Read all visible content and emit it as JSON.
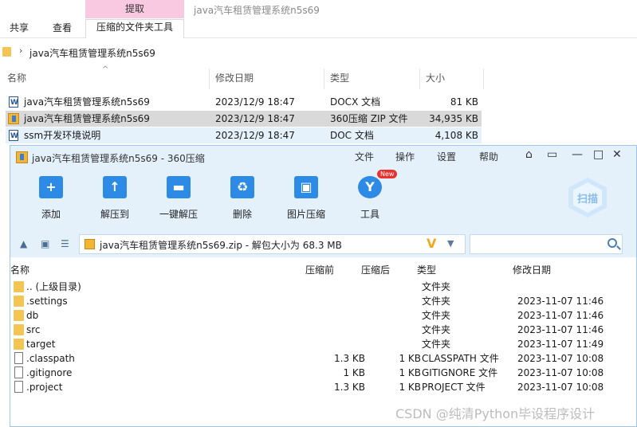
{
  "explorer": {
    "ribbon": {
      "context_header": "提取",
      "window_title": "java汽车租赁管理系统n5s69",
      "tabs": [
        "共享",
        "查看",
        "压缩的文件夹工具"
      ]
    },
    "address": "java汽车租赁管理系统n5s69",
    "columns": [
      "名称",
      "修改日期",
      "类型",
      "大小"
    ],
    "files": [
      {
        "name": "java汽车租赁管理系统n5s69",
        "date": "2023/12/9 18:47",
        "type": "DOCX 文档",
        "size": "81 KB",
        "icon": "word-doc-icon"
      },
      {
        "name": "java汽车租赁管理系统n5s69",
        "date": "2023/12/9 18:47",
        "type": "360压缩 ZIP 文件",
        "size": "34,935 KB",
        "icon": "zip-icon"
      },
      {
        "name": "ssm开发环境说明",
        "date": "2023/12/9 18:47",
        "type": "DOC 文档",
        "size": "4,108 KB",
        "icon": "word-doc-icon"
      }
    ]
  },
  "zip": {
    "title": "java汽车租赁管理系统n5s69 - 360压缩",
    "menu": [
      "文件",
      "操作",
      "设置",
      "帮助"
    ],
    "toolbar": [
      {
        "label": "添加",
        "icon": "add-icon"
      },
      {
        "label": "解压到",
        "icon": "extract-to-icon"
      },
      {
        "label": "一键解压",
        "icon": "one-click-extract-icon"
      },
      {
        "label": "删除",
        "icon": "delete-icon"
      },
      {
        "label": "图片压缩",
        "icon": "image-compress-icon"
      },
      {
        "label": "工具",
        "icon": "tools-icon",
        "badge": "New"
      }
    ],
    "scan_label": "扫描",
    "path": "java汽车租赁管理系统n5s69.zip - 解包大小为 68.3 MB",
    "path_badge": "V",
    "columns": [
      "名称",
      "压缩前",
      "压缩后",
      "类型",
      "修改日期"
    ],
    "rows": [
      {
        "name": ".. (上级目录)",
        "before": "",
        "after": "",
        "type": "文件夹",
        "date": "",
        "kind": "folder"
      },
      {
        "name": ".settings",
        "before": "",
        "after": "",
        "type": "文件夹",
        "date": "2023-11-07 11:46",
        "kind": "folder"
      },
      {
        "name": "db",
        "before": "",
        "after": "",
        "type": "文件夹",
        "date": "2023-11-07 11:46",
        "kind": "folder"
      },
      {
        "name": "src",
        "before": "",
        "after": "",
        "type": "文件夹",
        "date": "2023-11-07 11:46",
        "kind": "folder"
      },
      {
        "name": "target",
        "before": "",
        "after": "",
        "type": "文件夹",
        "date": "2023-11-07 11:49",
        "kind": "folder"
      },
      {
        "name": ".classpath",
        "before": "1.3 KB",
        "after": "1 KB",
        "type": "CLASSPATH 文件",
        "date": "2023-11-07 10:08",
        "kind": "file"
      },
      {
        "name": ".gitignore",
        "before": "1 KB",
        "after": "1 KB",
        "type": "GITIGNORE 文件",
        "date": "2023-11-07 10:08",
        "kind": "file"
      },
      {
        "name": ".project",
        "before": "1.3 KB",
        "after": "1 KB",
        "type": "PROJECT 文件",
        "date": "2023-11-07 10:08",
        "kind": "file"
      }
    ]
  },
  "watermark": "CSDN @纯清Python毕设程序设计",
  "colors": {
    "accent_blue": "#2d8be6",
    "zip_header_bg": "#e4f1fb",
    "selected_row": "#d9d9d9",
    "context_tab_pink": "#f8c9e0"
  }
}
